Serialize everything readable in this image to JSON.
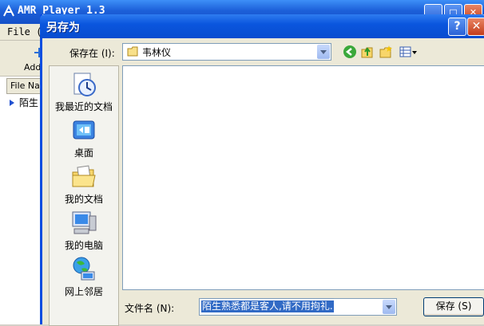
{
  "background_app": {
    "title": "AMR Player 1.3",
    "menu_file": "File (",
    "toolbar_add": "Add",
    "list_header": "File Name",
    "list_row": "陌生"
  },
  "dialog": {
    "title": "另存为",
    "help_label": "?",
    "close_label": "✕",
    "save_in_label": "保存在 (I):",
    "save_in_value": "韦林仪",
    "places": [
      {
        "label": "我最近的文档",
        "icon": "recent-documents-icon"
      },
      {
        "label": "桌面",
        "icon": "desktop-icon"
      },
      {
        "label": "我的文档",
        "icon": "my-documents-icon"
      },
      {
        "label": "我的电脑",
        "icon": "my-computer-icon"
      },
      {
        "label": "网上邻居",
        "icon": "network-places-icon"
      }
    ],
    "filename_label": "文件名 (N):",
    "filename_value": "陌生熟悉都是客人,请不用拘礼.",
    "save_button": "保存 (S)"
  },
  "colors": {
    "title_blue": "#0a56de",
    "selection_blue": "#316ac5",
    "dialog_bg": "#ece9d8"
  }
}
